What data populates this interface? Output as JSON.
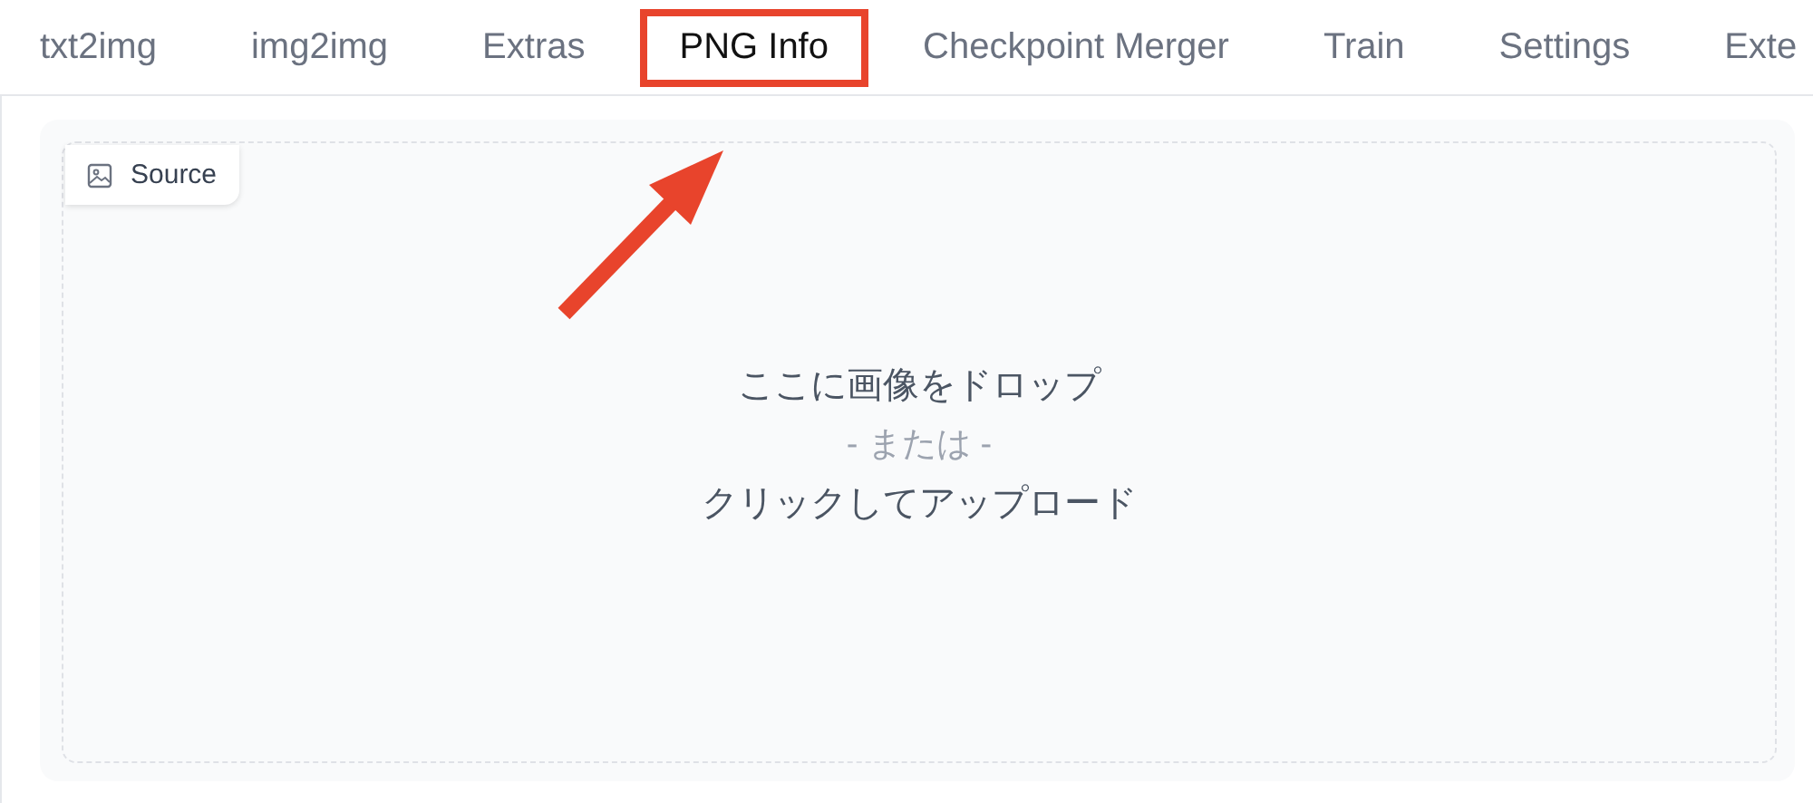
{
  "tabs": [
    {
      "label": "txt2img",
      "selected": false,
      "highlighted": false
    },
    {
      "label": "img2img",
      "selected": false,
      "highlighted": false
    },
    {
      "label": "Extras",
      "selected": false,
      "highlighted": false
    },
    {
      "label": "PNG Info",
      "selected": true,
      "highlighted": true
    },
    {
      "label": "Checkpoint Merger",
      "selected": false,
      "highlighted": false
    },
    {
      "label": "Train",
      "selected": false,
      "highlighted": false
    },
    {
      "label": "Settings",
      "selected": false,
      "highlighted": false
    },
    {
      "label": "Exte",
      "selected": false,
      "highlighted": false
    }
  ],
  "source": {
    "label": "Source",
    "drop_text": "ここに画像をドロップ",
    "or_text": "- または -",
    "click_text": "クリックしてアップロード"
  },
  "annotation": {
    "kind": "arrow"
  }
}
